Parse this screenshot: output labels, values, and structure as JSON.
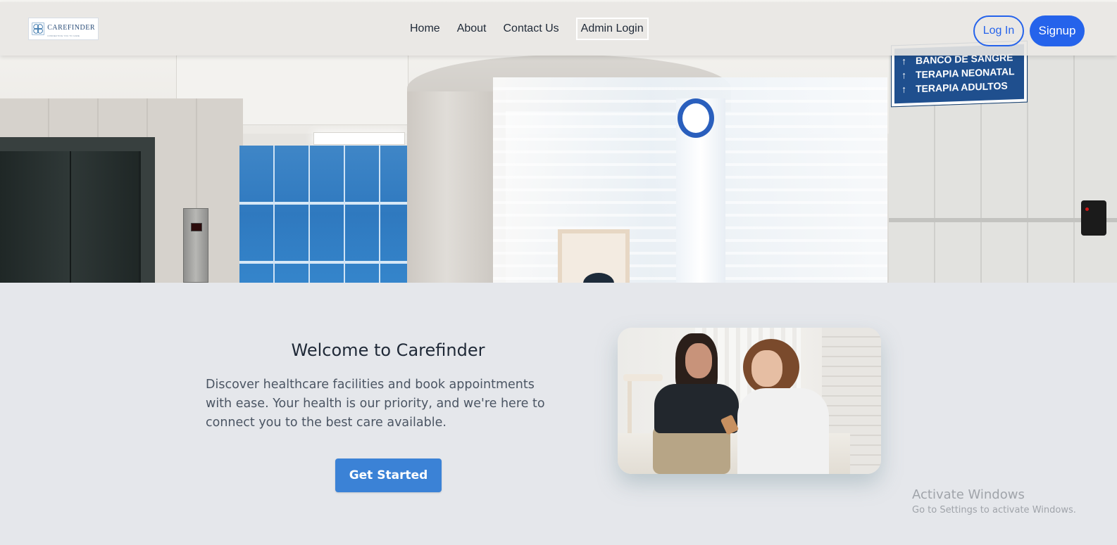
{
  "navbar": {
    "logo_text": "CAREFINDER",
    "logo_tagline": "CONNECTING YOU TO CARE",
    "links": [
      {
        "label": "Home"
      },
      {
        "label": "About"
      },
      {
        "label": "Contact Us"
      },
      {
        "label": "Admin Login"
      }
    ],
    "login_label": "Log In",
    "signup_label": "Signup"
  },
  "hero": {
    "sign_lines": [
      "BANCO DE SANGRE",
      "TERAPIA NEONATAL",
      "TERAPIA ADULTOS"
    ]
  },
  "welcome": {
    "title": "Welcome to Carefinder",
    "description": "Discover healthcare facilities and book appointments with ease. Your health is our priority, and we're here to connect you to the best care available.",
    "cta_label": "Get Started"
  },
  "watermark": {
    "title": "Activate Windows",
    "subtitle": "Go to Settings to activate Windows."
  },
  "colors": {
    "primary": "#2563eb",
    "cta": "#3b82d6",
    "background": "#e5e7eb",
    "text_dark": "#1f2937",
    "text_muted": "#4b5563"
  }
}
